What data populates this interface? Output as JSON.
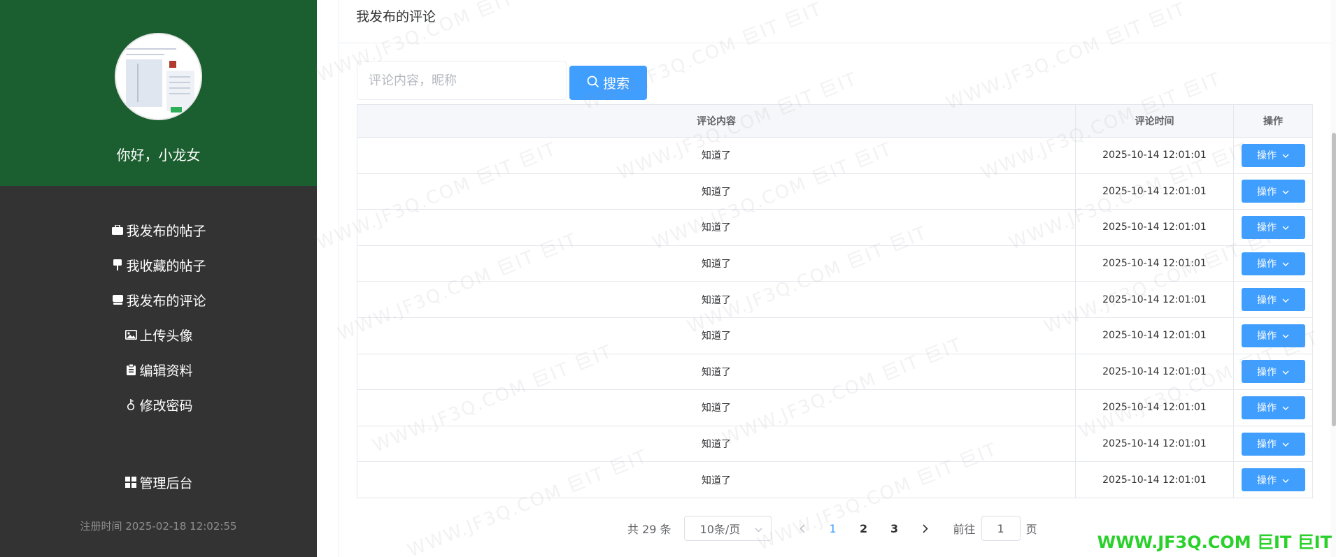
{
  "sidebar": {
    "greeting": "你好，小龙女",
    "menu": [
      {
        "label": "我发布的帖子",
        "icon": "briefcase-icon"
      },
      {
        "label": "我收藏的帖子",
        "icon": "pin-icon"
      },
      {
        "label": "我发布的评论",
        "icon": "inbox-icon"
      },
      {
        "label": "上传头像",
        "icon": "picture-icon"
      },
      {
        "label": "编辑资料",
        "icon": "clipboard-icon"
      },
      {
        "label": "修改密码",
        "icon": "key-icon"
      }
    ],
    "admin_label": "管理后台",
    "register_time": "注册时间 2025-02-18 12:02:55"
  },
  "card": {
    "title": "我发布的评论",
    "search": {
      "placeholder": "评论内容，昵称",
      "button_label": "搜索"
    },
    "table": {
      "headers": [
        "评论内容",
        "评论时间",
        "操作"
      ],
      "rows": [
        {
          "content": "知道了",
          "time": "2025-10-14 12:01:01",
          "action": "操作"
        },
        {
          "content": "知道了",
          "time": "2025-10-14 12:01:01",
          "action": "操作"
        },
        {
          "content": "知道了",
          "time": "2025-10-14 12:01:01",
          "action": "操作"
        },
        {
          "content": "知道了",
          "time": "2025-10-14 12:01:01",
          "action": "操作"
        },
        {
          "content": "知道了",
          "time": "2025-10-14 12:01:01",
          "action": "操作"
        },
        {
          "content": "知道了",
          "time": "2025-10-14 12:01:01",
          "action": "操作"
        },
        {
          "content": "知道了",
          "time": "2025-10-14 12:01:01",
          "action": "操作"
        },
        {
          "content": "知道了",
          "time": "2025-10-14 12:01:01",
          "action": "操作"
        },
        {
          "content": "知道了",
          "time": "2025-10-14 12:01:01",
          "action": "操作"
        },
        {
          "content": "知道了",
          "time": "2025-10-14 12:01:01",
          "action": "操作"
        }
      ]
    },
    "pagination": {
      "total": "共 29 条",
      "page_size": "10条/页",
      "pages": [
        "1",
        "2",
        "3"
      ],
      "current_page": "1",
      "goto_prefix": "前往",
      "goto_value": "1",
      "goto_suffix": "页"
    }
  },
  "watermark": {
    "text": "WWW.JF3Q.COM 巨IT 巨IT",
    "corner_text": "WWW.JF3Q.COM 巨IT 巨IT"
  },
  "colors": {
    "sidebar_top": "#1b5e2f",
    "sidebar_bg": "#333333",
    "primary": "#409eff",
    "watermark_corner": "#2bd12b"
  }
}
